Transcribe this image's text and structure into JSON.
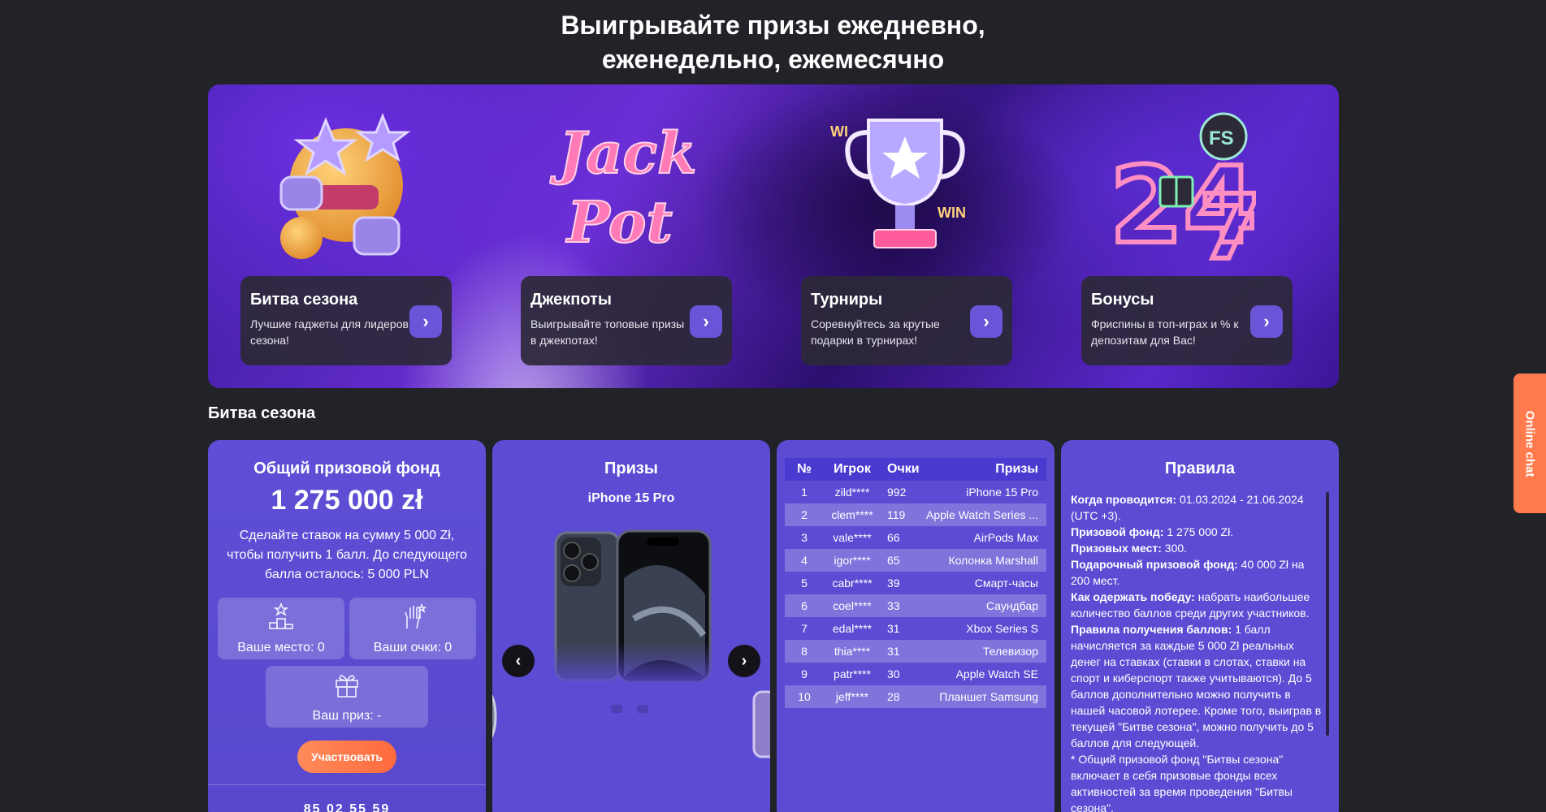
{
  "page": {
    "title": "Выигрывайте призы ежедневно,\nеженедельно, ежемесячно"
  },
  "promos": [
    {
      "title": "Битва сезона",
      "desc": "Лучшие гаджеты для лидеров сезона!",
      "art": "emoji-stars-thumbs-up",
      "btn_icon": "chevron-right-icon"
    },
    {
      "title": "Джекпоты",
      "desc": "Выигрывайте топовые призы в джекпотах!",
      "art": "jackpot-neon",
      "btn_icon": "chevron-right-icon"
    },
    {
      "title": "Турниры",
      "desc": "Соревнуйтесь за крутые подарки в турнирах!",
      "art": "trophy-win",
      "btn_icon": "chevron-right-icon"
    },
    {
      "title": "Бонусы",
      "desc": "Фриспины в топ-играх и % к депозитам для Вас!",
      "art": "24-7-fs-gift",
      "btn_icon": "chevron-right-icon"
    }
  ],
  "section": {
    "title": "Битва сезона"
  },
  "fund_panel": {
    "title": "Общий призовой фонд",
    "amount": "1 275 000 zł",
    "note": "Сделайте ставок на сумму 5 000 Zł, чтобы получить 1 балл. До следующего балла осталось: 5 000 PLN",
    "place_label": "Ваше место: 0",
    "points_label": "Ваши очки: 0",
    "prize_label": "Ваш приз: -",
    "join_label": "Участвовать",
    "timer": "85 02 55 59"
  },
  "prizes_panel": {
    "title": "Призы",
    "current_prize": "iPhone 15 Pro",
    "prev_icon": "chevron-left-icon",
    "next_icon": "chevron-right-icon"
  },
  "leaderboard": {
    "headers": {
      "no": "№",
      "player": "Игрок",
      "points": "Очки",
      "prize": "Призы"
    },
    "rows": [
      {
        "no": "1",
        "player": "zild****",
        "points": "992",
        "prize": "iPhone 15 Pro"
      },
      {
        "no": "2",
        "player": "clem****",
        "points": "119",
        "prize": "Apple Watch Series ..."
      },
      {
        "no": "3",
        "player": "vale****",
        "points": "66",
        "prize": "AirPods Max"
      },
      {
        "no": "4",
        "player": "igor****",
        "points": "65",
        "prize": "Колонка Marshall"
      },
      {
        "no": "5",
        "player": "cabr****",
        "points": "39",
        "prize": "Смарт-часы"
      },
      {
        "no": "6",
        "player": "coel****",
        "points": "33",
        "prize": "Саундбар"
      },
      {
        "no": "7",
        "player": "edal****",
        "points": "31",
        "prize": "Xbox Series S"
      },
      {
        "no": "8",
        "player": "thia****",
        "points": "31",
        "prize": "Телевизор"
      },
      {
        "no": "9",
        "player": "patr****",
        "points": "30",
        "prize": "Apple Watch SE"
      },
      {
        "no": "10",
        "player": "jeff****",
        "points": "28",
        "prize": "Планшет Samsung"
      }
    ]
  },
  "rules_panel": {
    "title": "Правила",
    "items": [
      {
        "label": "Когда проводится:",
        "text": " 01.03.2024 - 21.06.2024 (UTC +3)."
      },
      {
        "label": "Призовой фонд:",
        "text": " 1 275 000 Zł."
      },
      {
        "label": "Призовых мест:",
        "text": " 300."
      },
      {
        "label": "Подарочный призовой фонд:",
        "text": " 40 000 Zł на 200 мест."
      },
      {
        "label": "Как одержать победу:",
        "text": " набрать наибольшее количество баллов среди других участников."
      },
      {
        "label": "Правила получения баллов:",
        "text": " 1 балл начисляется за каждые 5 000 Zł реальных денег на ставках (ставки в слотах, ставки на спорт и киберспорт также учитываются). До 5 баллов дополнительно можно получить в нашей часовой лотерее. Кроме того, выиграв в текущей \"Битве сезона\", можно получить до 5 баллов для следующей."
      },
      {
        "label": "",
        "text": "* Общий призовой фонд \"Битвы сезона\" включает в себя призовые фонды всех активностей за время проведения \"Битвы сезона\"."
      }
    ]
  },
  "chat": {
    "label": "Online chat"
  },
  "colors": {
    "background": "#222328",
    "panel": "#5b4cd3",
    "accent": "#6a55d8",
    "cta": "#ff6a3d",
    "chat_tab": "#ff7a4d"
  }
}
